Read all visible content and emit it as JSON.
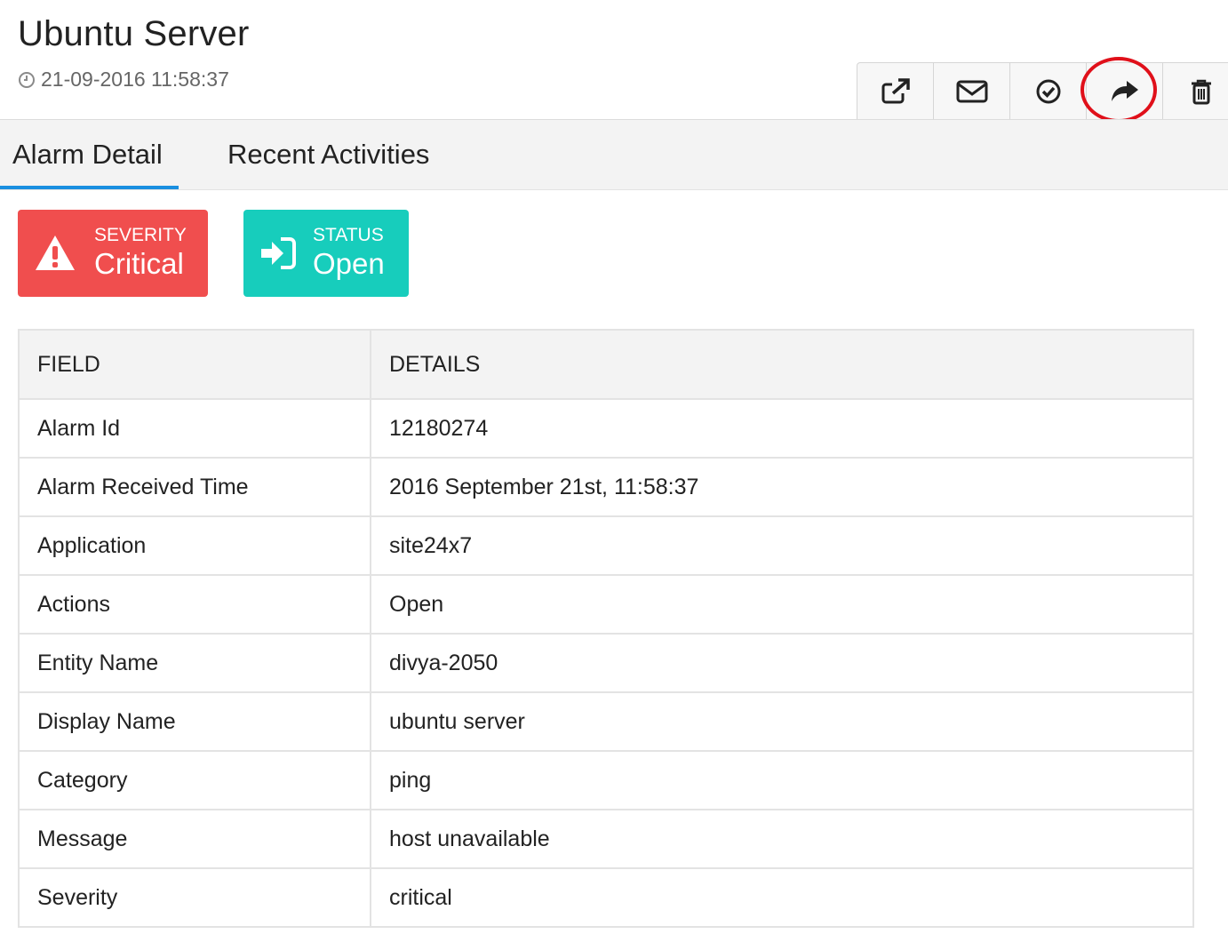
{
  "header": {
    "title": "Ubuntu Server",
    "timestamp": "21-09-2016 11:58:37"
  },
  "toolbar": {
    "buttons": [
      {
        "icon": "external-link-icon"
      },
      {
        "icon": "envelope-icon"
      },
      {
        "icon": "check-circle-icon"
      },
      {
        "icon": "share-forward-icon",
        "highlighted": true
      },
      {
        "icon": "trash-icon"
      }
    ],
    "highlight_color": "#e0101a"
  },
  "tabs": [
    {
      "label": "Alarm Detail",
      "active": true
    },
    {
      "label": "Recent Activities",
      "active": false
    }
  ],
  "severity": {
    "label": "SEVERITY",
    "value": "Critical",
    "color": "#f04e4e",
    "icon": "warning-triangle-icon"
  },
  "status": {
    "label": "STATUS",
    "value": "Open",
    "color": "#17cdbc",
    "icon": "sign-in-icon"
  },
  "table": {
    "headers": [
      "FIELD",
      "DETAILS"
    ],
    "rows": [
      {
        "field": "Alarm Id",
        "details": "12180274"
      },
      {
        "field": "Alarm Received Time",
        "details": "2016 September 21st, 11:58:37"
      },
      {
        "field": "Application",
        "details": "site24x7"
      },
      {
        "field": "Actions",
        "details": "Open"
      },
      {
        "field": "Entity Name",
        "details": "divya-2050"
      },
      {
        "field": "Display Name",
        "details": "ubuntu server"
      },
      {
        "field": "Category",
        "details": "ping"
      },
      {
        "field": "Message",
        "details": "host unavailable"
      },
      {
        "field": "Severity",
        "details": "critical"
      }
    ]
  }
}
